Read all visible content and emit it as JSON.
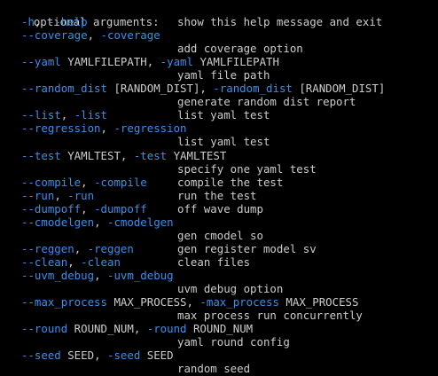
{
  "header": "optional arguments:",
  "colors": {
    "background": "#000000",
    "text": "#cccccc",
    "option": "#3b8eea"
  },
  "options": [
    {
      "parts": [
        {
          "t": "-h",
          "c": "opt"
        },
        {
          "t": ", ",
          "c": "txt"
        },
        {
          "t": "--help",
          "c": "opt"
        }
      ],
      "inline_desc": "show this help message and exit"
    },
    {
      "parts": [
        {
          "t": "--coverage",
          "c": "opt"
        },
        {
          "t": ", ",
          "c": "txt"
        },
        {
          "t": "-coverage",
          "c": "opt"
        }
      ],
      "desc": "add coverage option"
    },
    {
      "parts": [
        {
          "t": "--yaml",
          "c": "opt"
        },
        {
          "t": " YAMLFILEPATH, ",
          "c": "txt"
        },
        {
          "t": "-yaml",
          "c": "opt"
        },
        {
          "t": " YAMLFILEPATH",
          "c": "txt"
        }
      ],
      "desc": "yaml file path"
    },
    {
      "parts": [
        {
          "t": "--random_dist",
          "c": "opt"
        },
        {
          "t": " [RANDOM_DIST], ",
          "c": "txt"
        },
        {
          "t": "-random_dist",
          "c": "opt"
        },
        {
          "t": " [RANDOM_DIST]",
          "c": "txt"
        }
      ],
      "desc": "generate random dist report"
    },
    {
      "parts": [
        {
          "t": "--list",
          "c": "opt"
        },
        {
          "t": ", ",
          "c": "txt"
        },
        {
          "t": "-list",
          "c": "opt"
        }
      ],
      "inline_desc": "list yaml test"
    },
    {
      "parts": [
        {
          "t": "--regression",
          "c": "opt"
        },
        {
          "t": ", ",
          "c": "txt"
        },
        {
          "t": "-regression",
          "c": "opt"
        }
      ],
      "desc": "list yaml test"
    },
    {
      "parts": [
        {
          "t": "--test",
          "c": "opt"
        },
        {
          "t": " YAMLTEST, ",
          "c": "txt"
        },
        {
          "t": "-test",
          "c": "opt"
        },
        {
          "t": " YAMLTEST",
          "c": "txt"
        }
      ],
      "desc": "specify one yaml test"
    },
    {
      "parts": [
        {
          "t": "--compile",
          "c": "opt"
        },
        {
          "t": ", ",
          "c": "txt"
        },
        {
          "t": "-compile",
          "c": "opt"
        }
      ],
      "inline_desc": "compile the test"
    },
    {
      "parts": [
        {
          "t": "--run",
          "c": "opt"
        },
        {
          "t": ", ",
          "c": "txt"
        },
        {
          "t": "-run",
          "c": "opt"
        }
      ],
      "inline_desc": "run the test"
    },
    {
      "parts": [
        {
          "t": "--dumpoff",
          "c": "opt"
        },
        {
          "t": ", ",
          "c": "txt"
        },
        {
          "t": "-dumpoff",
          "c": "opt"
        }
      ],
      "inline_desc": "off wave dump"
    },
    {
      "parts": [
        {
          "t": "--cmodelgen",
          "c": "opt"
        },
        {
          "t": ", ",
          "c": "txt"
        },
        {
          "t": "-cmodelgen",
          "c": "opt"
        }
      ],
      "desc": "gen cmodel so"
    },
    {
      "parts": [
        {
          "t": "--reggen",
          "c": "opt"
        },
        {
          "t": ", ",
          "c": "txt"
        },
        {
          "t": "-reggen",
          "c": "opt"
        }
      ],
      "inline_desc": "gen register model sv"
    },
    {
      "parts": [
        {
          "t": "--clean",
          "c": "opt"
        },
        {
          "t": ", ",
          "c": "txt"
        },
        {
          "t": "-clean",
          "c": "opt"
        }
      ],
      "inline_desc": "clean files"
    },
    {
      "parts": [
        {
          "t": "--uvm_debug",
          "c": "opt"
        },
        {
          "t": ", ",
          "c": "txt"
        },
        {
          "t": "-uvm_debug",
          "c": "opt"
        }
      ],
      "desc": "uvm debug option"
    },
    {
      "parts": [
        {
          "t": "--max_process",
          "c": "opt"
        },
        {
          "t": " MAX_PROCESS, ",
          "c": "txt"
        },
        {
          "t": "-max_process",
          "c": "opt"
        },
        {
          "t": " MAX_PROCESS",
          "c": "txt"
        }
      ],
      "desc": "max process run concurrently"
    },
    {
      "parts": [
        {
          "t": "--round",
          "c": "opt"
        },
        {
          "t": " ROUND_NUM, ",
          "c": "txt"
        },
        {
          "t": "-round",
          "c": "opt"
        },
        {
          "t": " ROUND_NUM",
          "c": "txt"
        }
      ],
      "desc": "yaml round config"
    },
    {
      "parts": [
        {
          "t": "--seed",
          "c": "opt"
        },
        {
          "t": " SEED, ",
          "c": "txt"
        },
        {
          "t": "-seed",
          "c": "opt"
        },
        {
          "t": " SEED",
          "c": "txt"
        }
      ],
      "desc": "random seed"
    }
  ]
}
